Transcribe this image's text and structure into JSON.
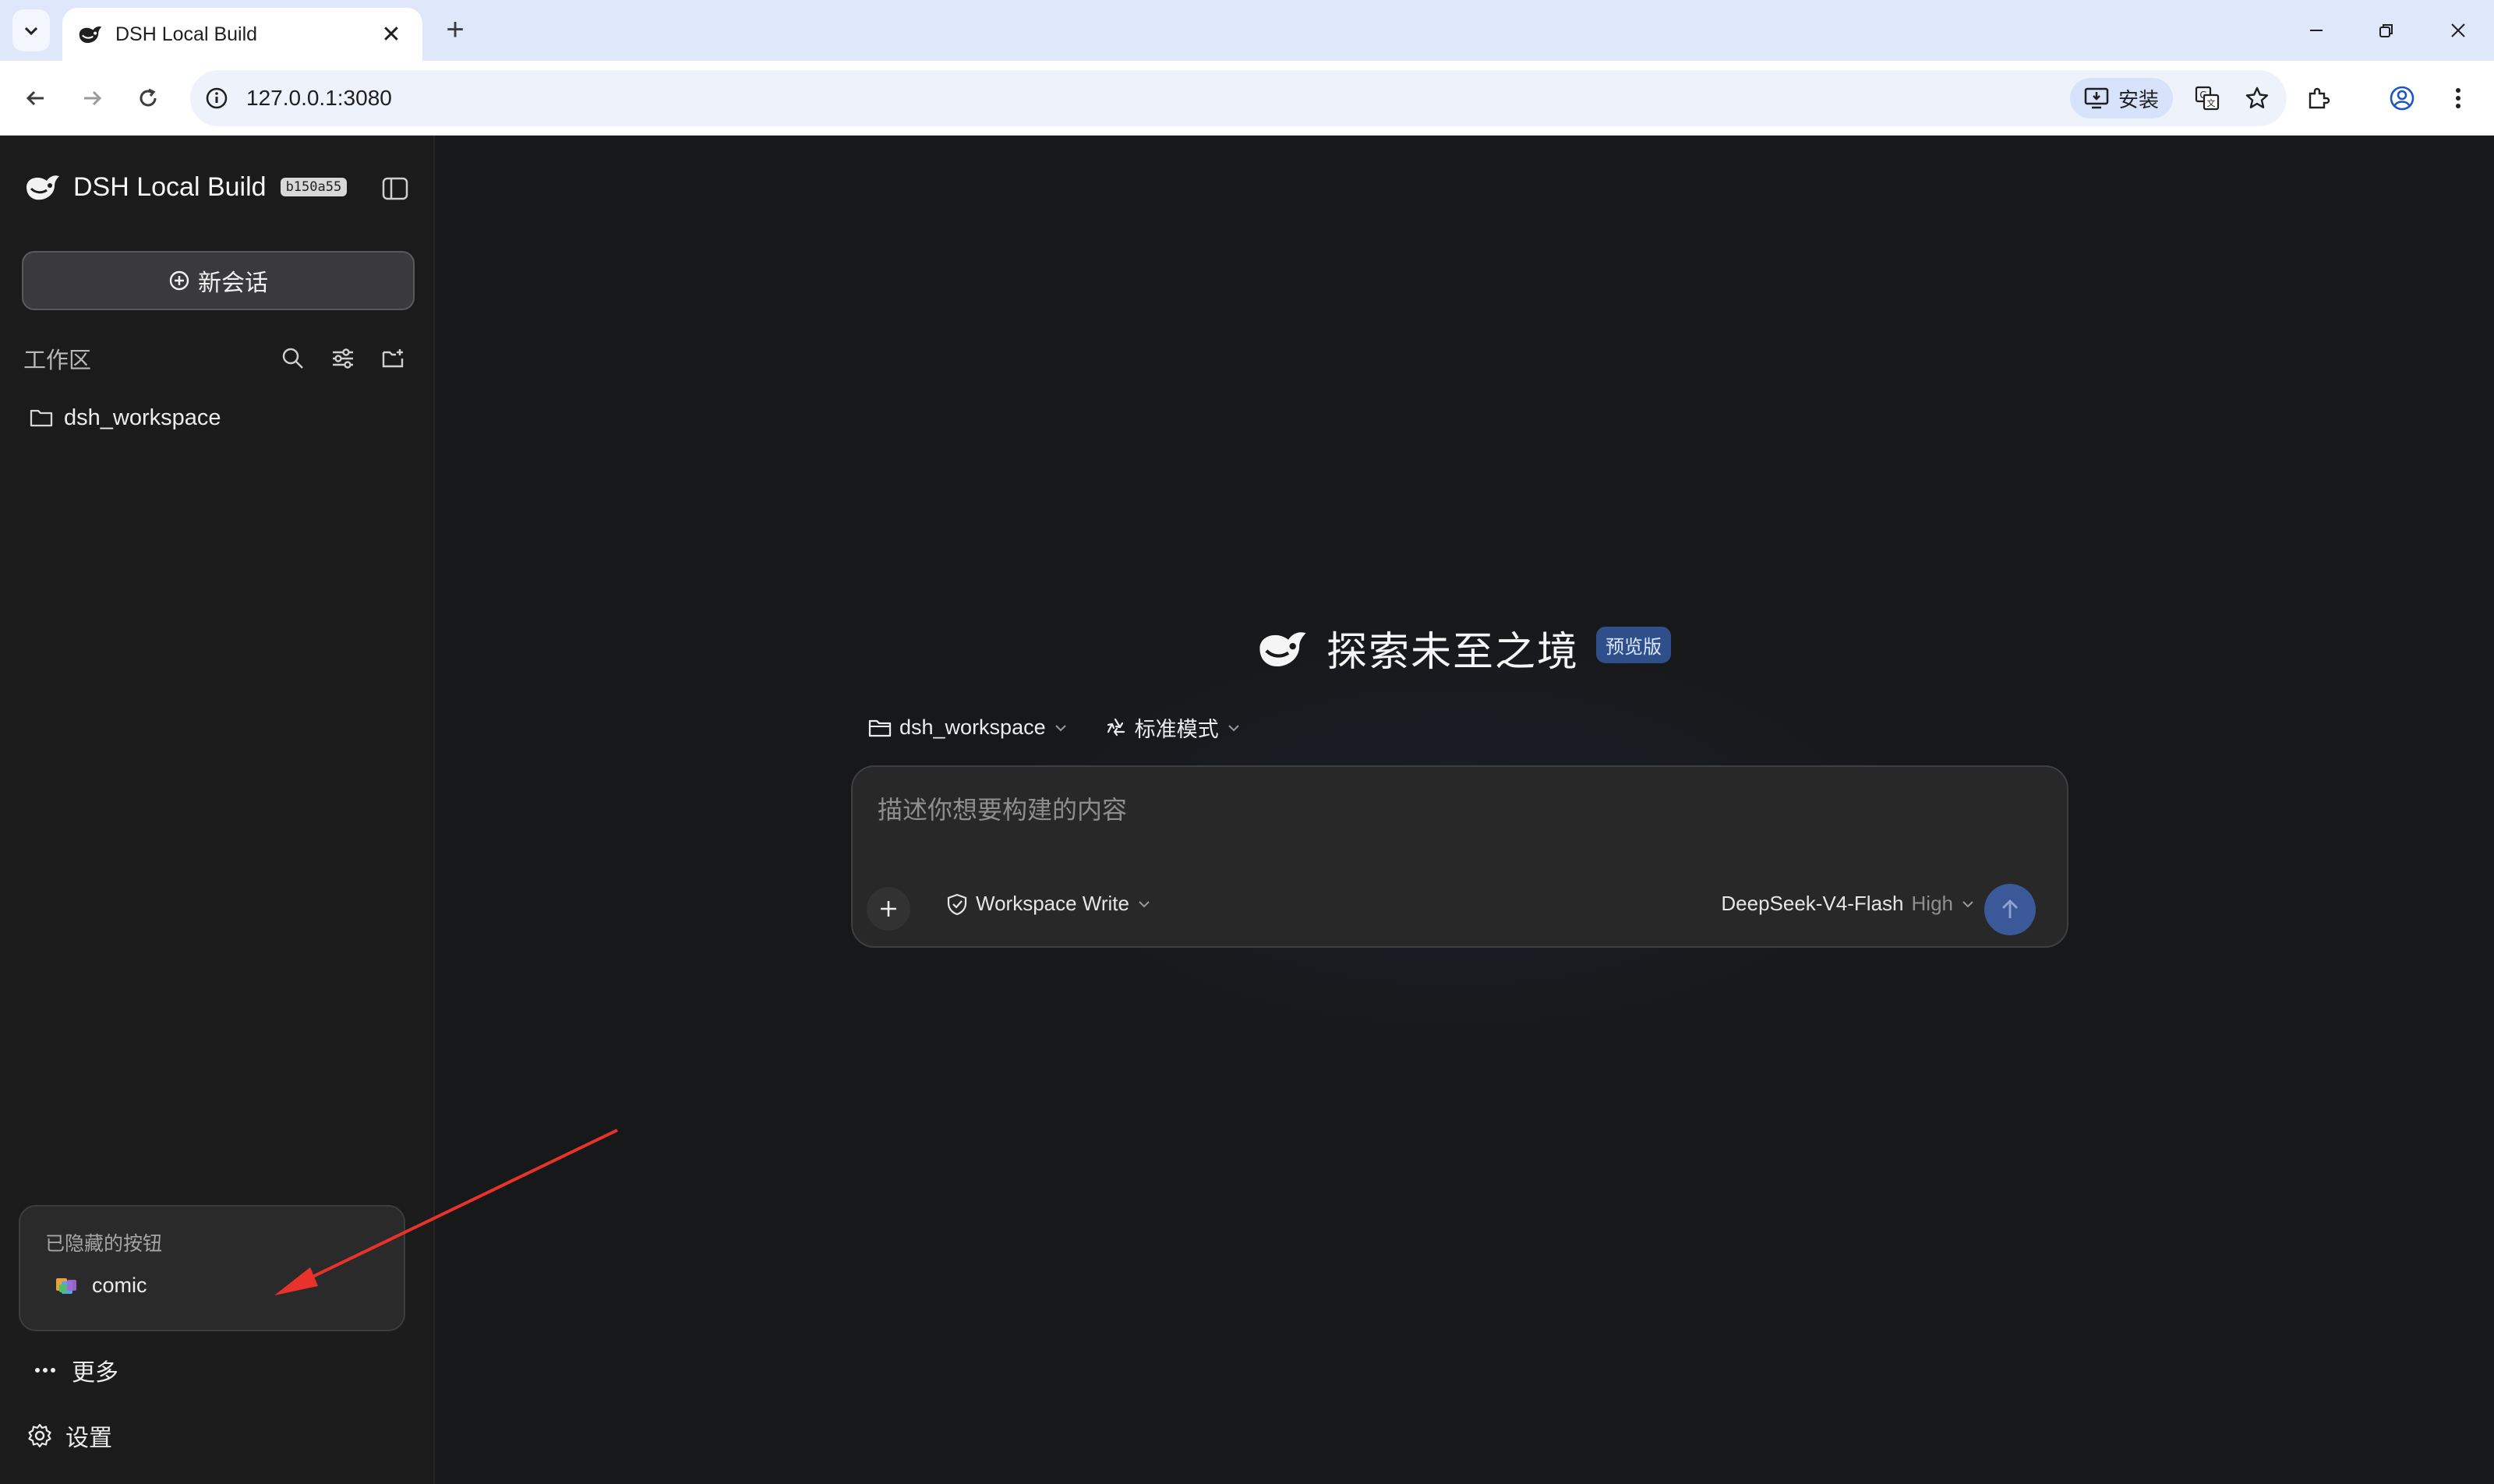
{
  "browser": {
    "tab_title": "DSH Local Build",
    "url": "127.0.0.1:3080",
    "install_label": "安装"
  },
  "sidebar": {
    "brand_name": "DSH Local Build",
    "build_hash": "b150a55",
    "new_chat_label": "新会话",
    "workspace_section_label": "工作区",
    "folders": [
      {
        "label": "dsh_workspace"
      }
    ],
    "hidden_panel": {
      "title": "已隐藏的按钮",
      "items": [
        {
          "label": "comic"
        }
      ]
    },
    "more_label": "更多",
    "settings_label": "设置"
  },
  "main": {
    "hero_title": "探索未至之境",
    "hero_badge": "预览版",
    "workspace_select": "dsh_workspace",
    "mode_select": "标准模式",
    "composer": {
      "placeholder": "描述你想要构建的内容",
      "permission_select": "Workspace Write",
      "model_name": "DeepSeek-V4-Flash",
      "model_effort": "High"
    }
  },
  "colors": {
    "accent": "#3b5998",
    "badge_bg": "#2f4f8a",
    "annotation_arrow": "#e8322a"
  }
}
